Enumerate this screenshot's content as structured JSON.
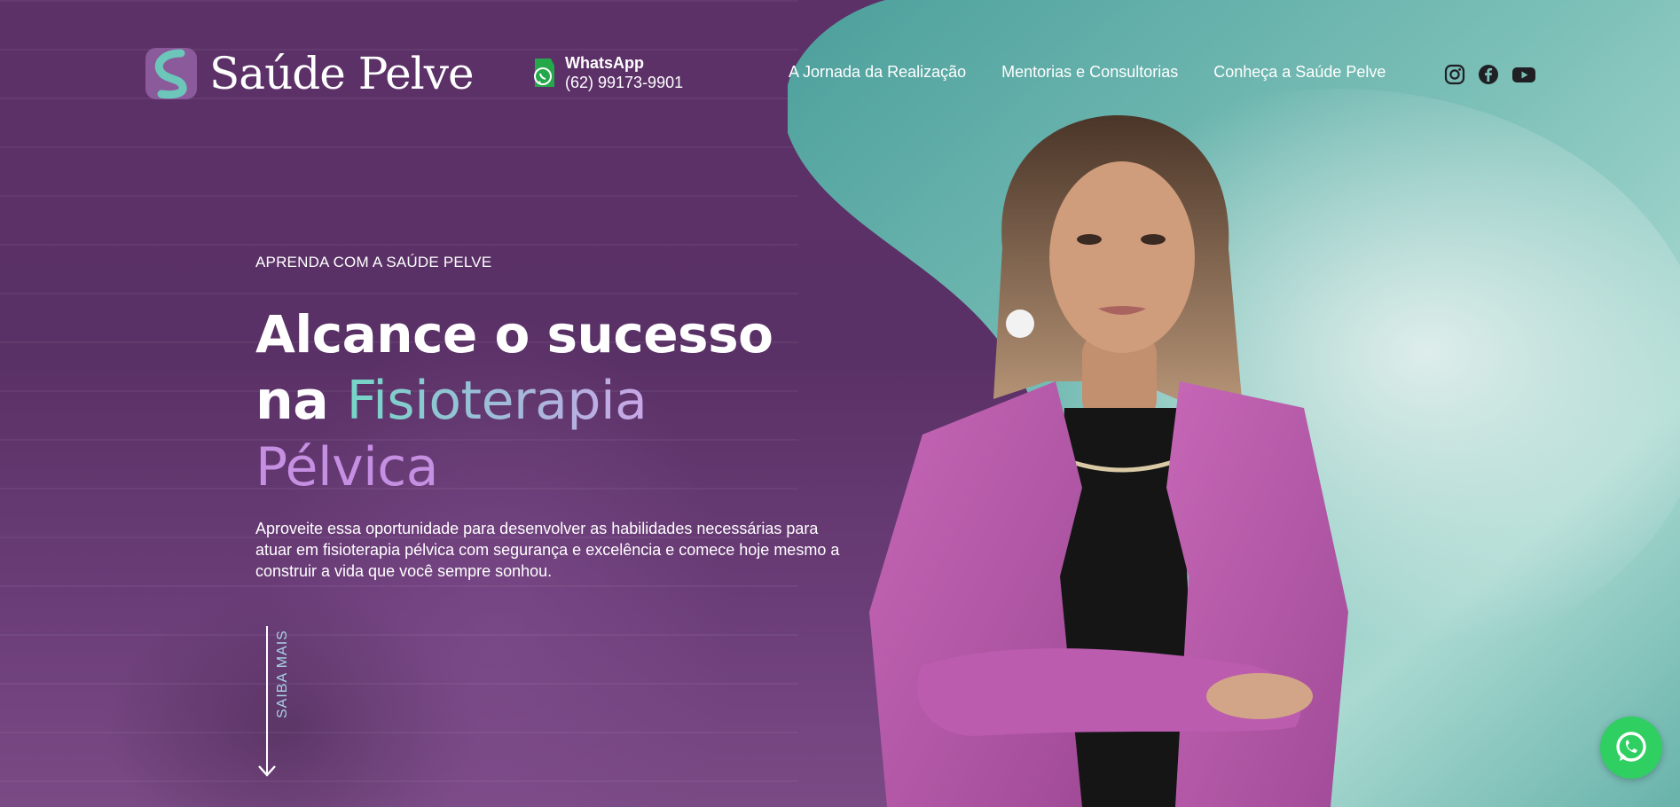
{
  "brand": {
    "name": "Saúde Pelve"
  },
  "contact": {
    "title": "WhatsApp",
    "phone": "(62) 99173-9901"
  },
  "nav": [
    {
      "label": "A Jornada da Realização"
    },
    {
      "label": "Mentorias e Consultorias"
    },
    {
      "label": "Conheça a Saúde Pelve"
    }
  ],
  "socials": [
    {
      "icon": "instagram-icon"
    },
    {
      "icon": "facebook-icon"
    },
    {
      "icon": "youtube-icon"
    }
  ],
  "hero": {
    "eyebrow": "APRENDA COM A SAÚDE PELVE",
    "headline_line1": "Alcance o sucesso",
    "headline_line2_plain": "na ",
    "headline_line2_highlight": "Fisioterapia",
    "headline_line3": "Pélvica",
    "lead": "Aproveite essa oportunidade para desenvolver as habilidades necessárias para atuar em fisioterapia pélvica com segurança e excelência  e comece hoje mesmo a construir a vida que você sempre sonhou.",
    "scroll_label": "SAIBA MAIS"
  },
  "colors": {
    "background": "#5a3166",
    "teal": "#6fb9b0",
    "accent_purple": "#c58fe2",
    "whatsapp_green": "#2fcf62"
  }
}
